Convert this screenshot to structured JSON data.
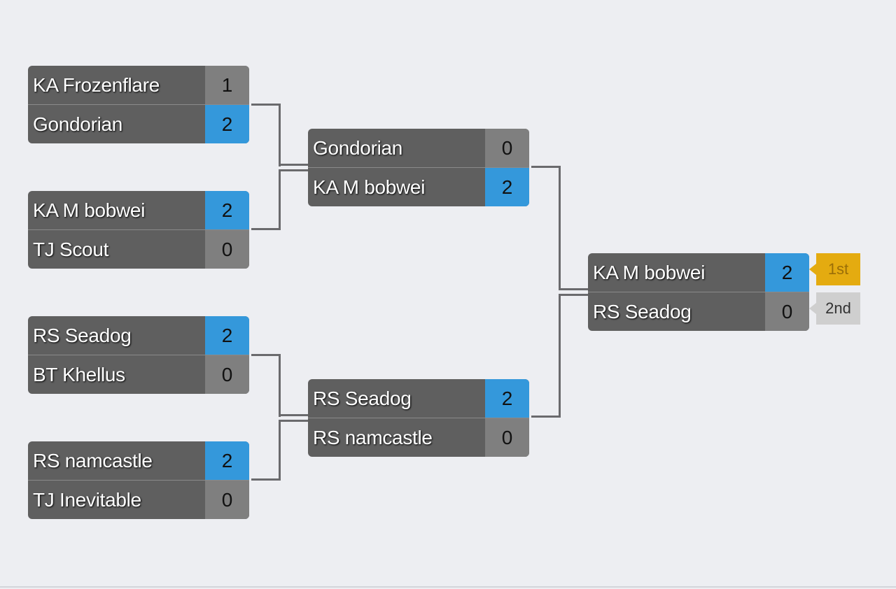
{
  "bracket": {
    "round1": [
      {
        "teams": [
          {
            "name": "KA Frozenflare",
            "score": "1",
            "win": false
          },
          {
            "name": "Gondorian",
            "score": "2",
            "win": true
          }
        ]
      },
      {
        "teams": [
          {
            "name": "KA M bobwei",
            "score": "2",
            "win": true
          },
          {
            "name": "TJ Scout",
            "score": "0",
            "win": false
          }
        ]
      },
      {
        "teams": [
          {
            "name": "RS Seadog",
            "score": "2",
            "win": true
          },
          {
            "name": "BT Khellus",
            "score": "0",
            "win": false
          }
        ]
      },
      {
        "teams": [
          {
            "name": "RS namcastle",
            "score": "2",
            "win": true
          },
          {
            "name": "TJ Inevitable",
            "score": "0",
            "win": false
          }
        ]
      }
    ],
    "round2": [
      {
        "teams": [
          {
            "name": "Gondorian",
            "score": "0",
            "win": false
          },
          {
            "name": "KA M bobwei",
            "score": "2",
            "win": true
          }
        ]
      },
      {
        "teams": [
          {
            "name": "RS Seadog",
            "score": "2",
            "win": true
          },
          {
            "name": "RS namcastle",
            "score": "0",
            "win": false
          }
        ]
      }
    ],
    "final": [
      {
        "teams": [
          {
            "name": "KA M bobwei",
            "score": "2",
            "win": true
          },
          {
            "name": "RS Seadog",
            "score": "0",
            "win": false
          }
        ]
      }
    ]
  },
  "placements": {
    "first": "1st",
    "second": "2nd"
  },
  "colors": {
    "win": "#3498db",
    "lose": "#7f7f7f",
    "first": "#e4ab10",
    "second": "#cfcfcf"
  }
}
